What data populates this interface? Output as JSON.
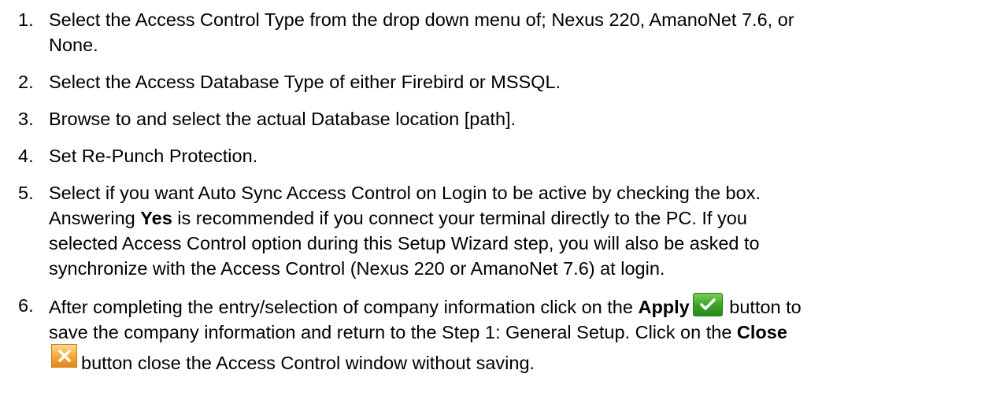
{
  "steps": [
    {
      "num": "1.",
      "lines": [
        "Select the Access Control Type from the drop down menu of; Nexus 220, AmanoNet 7.6, or",
        "None."
      ]
    },
    {
      "num": "2.",
      "text": "Select the Access Database Type of either Firebird or MSSQL."
    },
    {
      "num": "3.",
      "text": "Browse to and select the actual Database location [path]."
    },
    {
      "num": "4.",
      "text": "Set Re-Punch Protection."
    },
    {
      "num": "5.",
      "line1": "Select if you want Auto Sync Access Control on Login to be active by checking the box.",
      "line2_pre": "Answering ",
      "line2_bold": "Yes",
      "line2_post": " is recommended if you connect your terminal directly to the PC. If you",
      "line3": "selected Access Control option during this Setup Wizard step, you will also be asked to",
      "line4": "synchronize with the Access Control (Nexus 220 or AmanoNet 7.6) at login."
    },
    {
      "num": "6.",
      "line1_pre": "After completing the entry/selection of company information click on the ",
      "line1_bold": "Apply",
      "line1_post": " button to",
      "line2_pre": "save the company information and return to the Step 1: General Setup. Click on the ",
      "line2_bold": "Close",
      "line3": "button close the Access Control window without saving."
    }
  ],
  "icons": {
    "apply": "checkmark-icon",
    "close": "close-x-icon"
  },
  "colors": {
    "apply_green": "#39a224",
    "close_orange": "#f3a735"
  }
}
